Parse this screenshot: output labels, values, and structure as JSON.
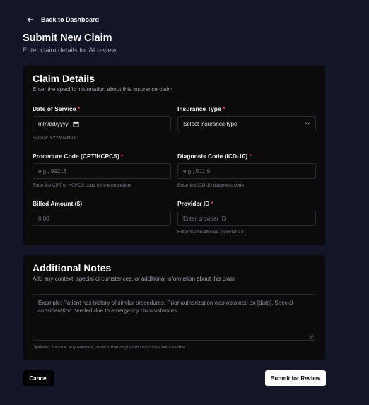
{
  "nav": {
    "back_label": "Back to Dashboard"
  },
  "header": {
    "title": "Submit New Claim",
    "subtitle": "Enter claim details for AI review"
  },
  "claim_details": {
    "title": "Claim Details",
    "subtitle": "Enter the specific information about this insurance claim",
    "date_of_service": {
      "label": "Date of Service",
      "required_mark": "*",
      "value": "mm/dd/yyyy",
      "hint": "Format: YYYY-MM-DD"
    },
    "insurance_type": {
      "label": "Insurance Type",
      "required_mark": "*",
      "selected": "Select insurance type"
    },
    "procedure_code": {
      "label": "Procedure Code (CPT/HCPCS)",
      "required_mark": "*",
      "placeholder": "e.g., 99213",
      "hint": "Enter the CPT or HCPCS code for the procedure"
    },
    "diagnosis_code": {
      "label": "Diagnosis Code (ICD-10)",
      "required_mark": "*",
      "placeholder": "e.g., E11.9",
      "hint": "Enter the ICD-10 diagnosis code"
    },
    "billed_amount": {
      "label": "Billed Amount ($)",
      "placeholder": "0.00"
    },
    "provider_id": {
      "label": "Provider ID",
      "required_mark": "*",
      "placeholder": "Enter provider ID",
      "hint": "Enter the healthcare provider's ID"
    }
  },
  "notes": {
    "title": "Additional Notes",
    "subtitle": "Add any context, special circumstances, or additional information about this claim",
    "placeholder": "Example: Patient has history of similar procedures. Prior authorization was obtained on [date]. Special consideration needed due to emergency circumstances...",
    "hint": "Optional: Include any relevant context that might help with the claim review"
  },
  "actions": {
    "cancel_label": "Cancel",
    "submit_label": "Submit for Review"
  },
  "colors": {
    "page_background": "#121626",
    "card_background": "#0b0b0c",
    "required": "#e5484d",
    "primary_button": "#ffffff"
  },
  "icons": {
    "back": "arrow-left-icon",
    "date": "calendar-icon",
    "select": "chevron-down-icon",
    "resize": "resize-handle-icon"
  }
}
